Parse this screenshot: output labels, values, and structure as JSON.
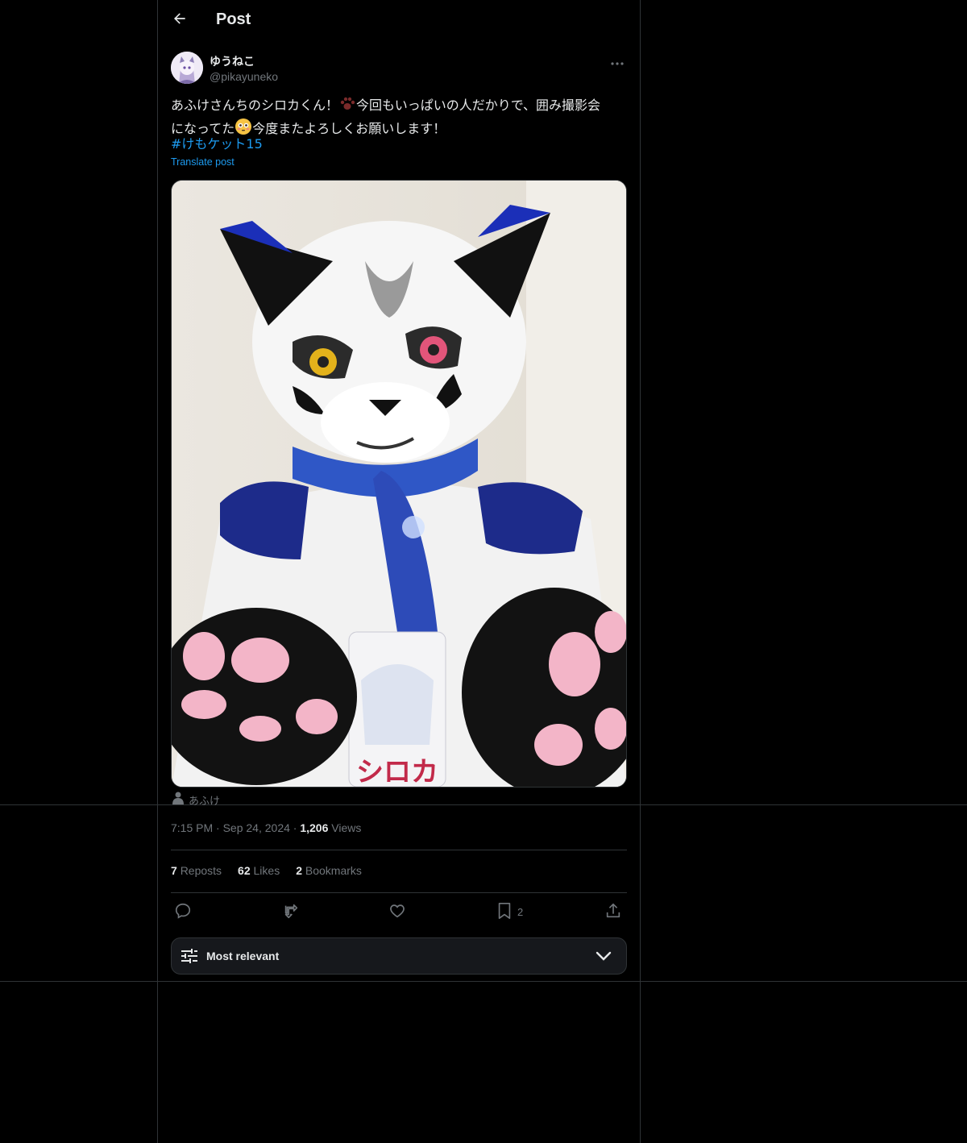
{
  "header": {
    "title": "Post"
  },
  "author": {
    "display_name": "ゆうねこ",
    "handle": "@pikayuneko"
  },
  "post": {
    "text_line1": "あふけさんちのシロカくん！",
    "text_line1b": "今回もいっぱいの人だかりで、囲み撮影会",
    "text_line2a": "になってた",
    "text_line2b": "今度またよろしくお願いします！",
    "hashtag": "#けもケット15",
    "translate_label": "Translate post",
    "media_caption": "シロカ",
    "tagged_user": "あふけ"
  },
  "meta": {
    "time": "7:15 PM",
    "separator": "·",
    "date": "Sep 24, 2024",
    "views_count": "1,206",
    "views_label": "Views"
  },
  "stats": {
    "reposts_count": "7",
    "reposts_label": "Reposts",
    "likes_count": "62",
    "likes_label": "Likes",
    "bookmarks_count": "2",
    "bookmarks_label": "Bookmarks"
  },
  "actions": {
    "bookmark_count": "2"
  },
  "replies_sort": {
    "label": "Most relevant"
  },
  "icons": [
    "back-arrow-icon",
    "more-icon",
    "paw-icon",
    "flushed-face-icon",
    "person-icon",
    "reply-icon",
    "repost-icon",
    "like-icon",
    "bookmark-icon",
    "share-icon",
    "sliders-icon",
    "chevron-down-icon"
  ],
  "colors": {
    "background": "#000000",
    "text_primary": "#e7e9ea",
    "text_secondary": "#71767b",
    "accent": "#1d9bf0",
    "border": "#2f3336"
  }
}
